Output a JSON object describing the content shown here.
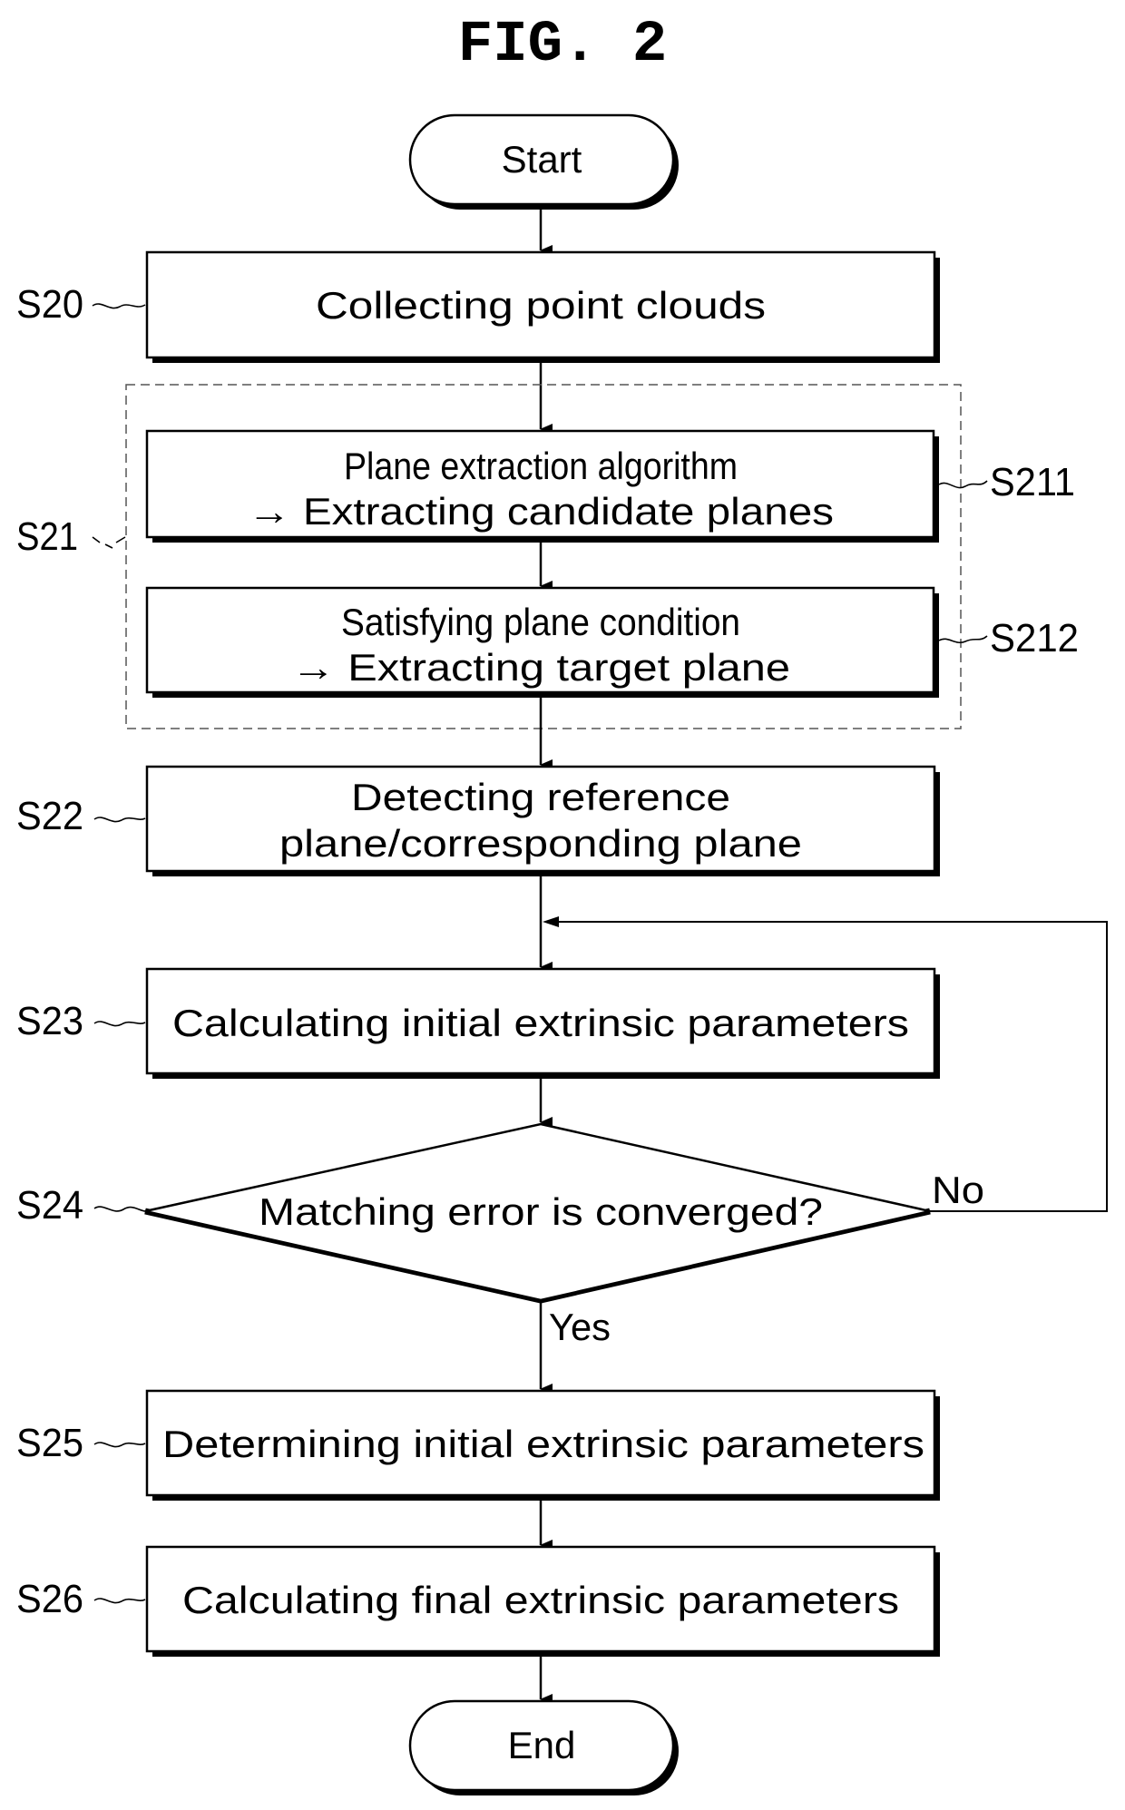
{
  "figure": {
    "title": "FIG. 2"
  },
  "terminals": {
    "start": "Start",
    "end": "End"
  },
  "steps": [
    {
      "id": "S20",
      "label": "S20",
      "lines": [
        "Collecting point clouds"
      ]
    },
    {
      "id": "S211",
      "label": "S211",
      "lines": [
        "Plane extraction algorithm",
        "→ Extracting candidate planes"
      ]
    },
    {
      "id": "S212",
      "label": "S212",
      "lines": [
        "Satisfying plane condition",
        "→ Extracting target plane"
      ]
    },
    {
      "id": "S22",
      "label": "S22",
      "lines": [
        "Detecting reference",
        "plane/corresponding plane"
      ]
    },
    {
      "id": "S23",
      "label": "S23",
      "lines": [
        "Calculating initial extrinsic parameters"
      ]
    },
    {
      "id": "S25",
      "label": "S25",
      "lines": [
        "Determining initial extrinsic parameters"
      ]
    },
    {
      "id": "S26",
      "label": "S26",
      "lines": [
        "Calculating final extrinsic parameters"
      ]
    }
  ],
  "group": {
    "id": "S21",
    "label": "S21"
  },
  "decision": {
    "id": "S24",
    "label": "S24",
    "question": "Matching error is converged?",
    "yes_label": "Yes",
    "no_label": "No"
  }
}
